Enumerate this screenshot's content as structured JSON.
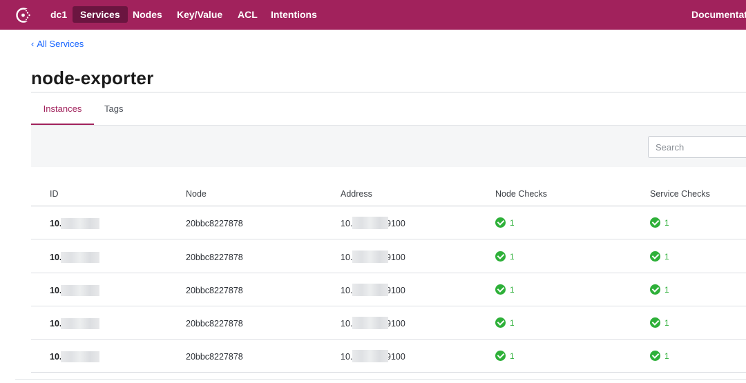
{
  "nav": {
    "datacenter": "dc1",
    "items": [
      "Services",
      "Nodes",
      "Key/Value",
      "ACL",
      "Intentions"
    ],
    "active": "Services",
    "docs": "Documentat"
  },
  "breadcrumb": {
    "label": "All Services"
  },
  "page_title": "node-exporter",
  "tabs": [
    "Instances",
    "Tags"
  ],
  "active_tab": "Instances",
  "search": {
    "placeholder": "Search",
    "value": ""
  },
  "table": {
    "headers": [
      "ID",
      "Node",
      "Address",
      "Node Checks",
      "Service Checks"
    ],
    "rows": [
      {
        "id": "10.",
        "node": "20bbc8227878",
        "address": "10.              9100",
        "node_checks": "1",
        "service_checks": "1"
      },
      {
        "id": "10.2",
        "node": "20bbc8227878",
        "address": "10.              9100",
        "node_checks": "1",
        "service_checks": "1"
      },
      {
        "id": "10.2",
        "node": "20bbc8227878",
        "address": "10.              9100",
        "node_checks": "1",
        "service_checks": "1"
      },
      {
        "id": "10.",
        "node": "20bbc8227878",
        "address": "10.              9100",
        "node_checks": "1",
        "service_checks": "1"
      },
      {
        "id": "10.",
        "node": "20bbc8227878",
        "address": "10.             :9100",
        "node_checks": "1",
        "service_checks": "1"
      }
    ]
  },
  "colors": {
    "brand": "#a1225c",
    "brand_dark": "#6b1540",
    "link": "#1563ff",
    "check_pass": "#2eb039"
  },
  "icons": {
    "logo": "consul-logo-icon",
    "check": "check-circle-icon",
    "back": "chevron-left-icon"
  }
}
